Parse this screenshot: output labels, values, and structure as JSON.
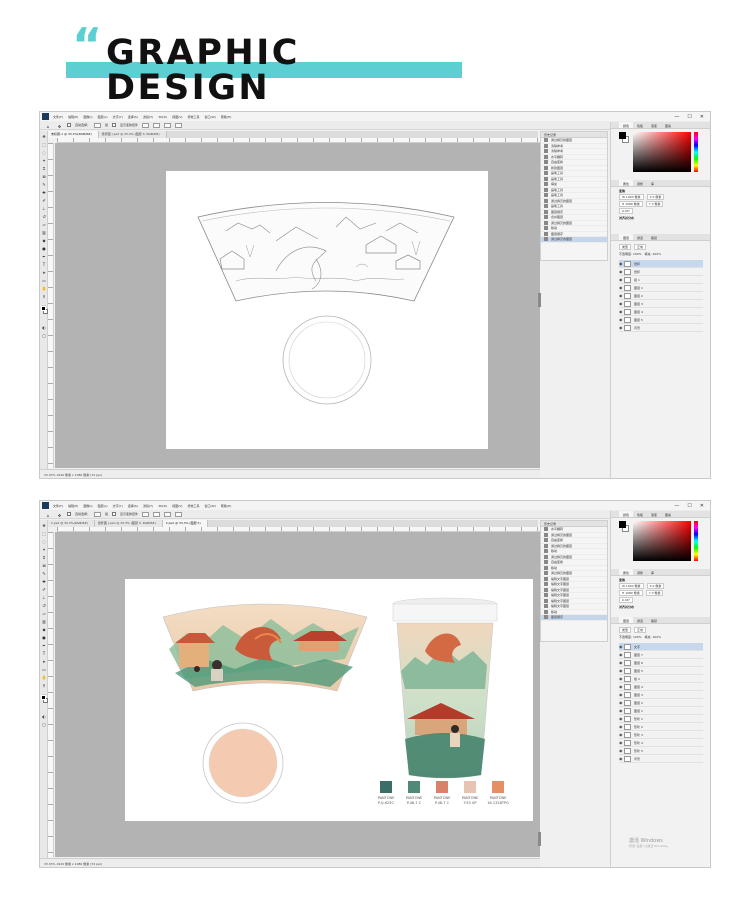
{
  "header": {
    "quote": "“",
    "title": "GRAPHIC DESIGN"
  },
  "ps_menu": [
    "文件(F)",
    "编辑(E)",
    "图像(I)",
    "图层(L)",
    "文字(Y)",
    "选择(S)",
    "滤镜(T)",
    "3D(D)",
    "视图(V)",
    "增效工具",
    "窗口(W)",
    "帮助(H)"
  ],
  "window_controls": [
    "—",
    "☐",
    "✕"
  ],
  "options": {
    "auto_select": "自动选择：",
    "group": "组",
    "show_transform": "显示变换控件"
  },
  "screens": [
    {
      "tabs": [
        "未标题-1 @ 33.3%(RGB/8#)",
        "纸杯图 (.psd @ 33.3% (图层 3, RGB/8#)"
      ],
      "status": "33.33%   1920 像素 x 1080 像素 (72 ppi)",
      "history_title": "历史记录",
      "history": [
        "通过拷贝的图层",
        "清除参考",
        "清除参考",
        "水平翻转",
        "自由变换",
        "新建图层",
        "画笔工具",
        "画笔工具",
        "填充",
        "画笔工具",
        "画笔工具",
        "通过拷贝的图层",
        "画笔工具",
        "图层顺序",
        "合并图层",
        "通过拷贝的图层",
        "移动",
        "图层顺序",
        "通过拷贝的图层"
      ],
      "layers": [
        "纸杯",
        "纸杯",
        "组 1",
        "图层 1",
        "图层 2",
        "图层 3",
        "图层 4",
        "图层 5",
        "背景"
      ]
    },
    {
      "tabs": [
        "1.psd @ 33.3%(RGB/8#)",
        "纸杯图 (.psd @ 33.3% (图层 5, RGB/8#)",
        "2.psd @ 33.3% (图层 5)"
      ],
      "status": "33.33%   1920 像素 x 1080 像素 (72 ppi)",
      "history_title": "历史记录",
      "history": [
        "水平翻转",
        "通过拷贝的图层",
        "自由变换",
        "通过拷贝的图层",
        "移动",
        "通过拷贝的图层",
        "自由变换",
        "移动",
        "通过拷贝的图层",
        "编辑文字图层",
        "编辑文字图层",
        "编辑文字图层",
        "编辑文字图层",
        "编辑文字图层",
        "编辑文字图层",
        "移动",
        "图层顺序"
      ],
      "layers": [
        "文字",
        "图层 7",
        "图层 6",
        "图层 5",
        "组 2",
        "图层 4",
        "图层 3",
        "图层 2",
        "图层 1",
        "形状 1",
        "形状 2",
        "形状 3",
        "形状 4",
        "形状 5",
        "背景"
      ]
    }
  ],
  "panels": {
    "color_tabs": [
      "颜色",
      "色板",
      "渐变",
      "图案"
    ],
    "props_tabs": [
      "属性",
      "调整",
      "库"
    ],
    "props_section": "变换",
    "props_fields": [
      "W  1920 像素",
      "H  1080 像素",
      "X  0 像素",
      "Y  0 像素",
      "0.00°"
    ],
    "props_section2": "对齐并分布",
    "layers_tabs": [
      "图层",
      "通道",
      "路径"
    ],
    "layers_filter": "类型",
    "blend_mode": "正常",
    "opacity": "不透明度: 100%",
    "fill": "填充: 100%"
  },
  "palette": [
    {
      "color": "#3b6e66",
      "name": "PANTONE",
      "code": "P.Q-625C"
    },
    {
      "color": "#4f8a78",
      "name": "PANTONE",
      "code": "P.48-7 C"
    },
    {
      "color": "#d9826a",
      "name": "PANTONE",
      "code": "P.48-7 C"
    },
    {
      "color": "#e6c3b2",
      "name": "PANTONE",
      "code": "T.93 UP"
    },
    {
      "color": "#e59064",
      "name": "PANTONE",
      "code": "16-1328TPG"
    }
  ],
  "activation": {
    "title": "激活 Windows",
    "subtitle": "转到“设置”以激活 Windows。"
  },
  "colors": {
    "accent": "#5ccfd2",
    "cup_pink": "#f4cbb0",
    "workspace": "#b3b3b3"
  }
}
